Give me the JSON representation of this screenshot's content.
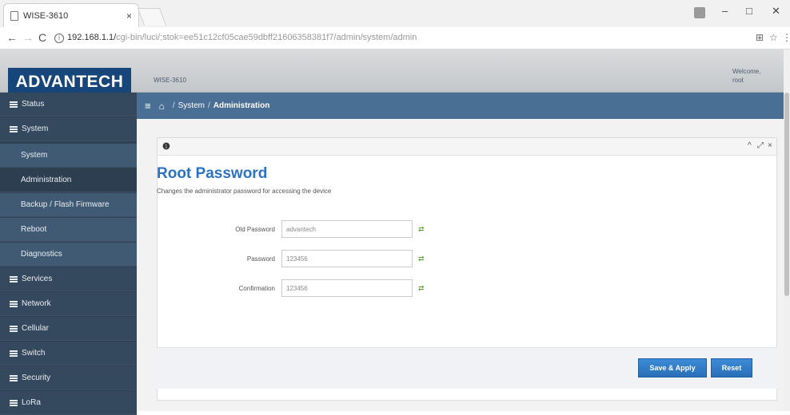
{
  "browser": {
    "tab_title": "WISE-3610",
    "tab_close": "×",
    "url_host": "192.168.1.1/",
    "url_path": "cgi-bin/luci/;stok=ee51c12cf05cae59dbff21606358381f7/admin/system/admin",
    "window_min": "–",
    "window_max": "□",
    "window_close": "✕",
    "back": "←",
    "forward": "→",
    "reload": "C",
    "info": "i",
    "translate_icon": "⊞",
    "bookmark_icon": "☆",
    "menu_icon": "⋮"
  },
  "header": {
    "logo": "ADVANTECH",
    "device_name": "WISE-3610",
    "welcome": "Welcome,",
    "user": "root"
  },
  "sidebar": {
    "items": [
      {
        "label": "Status"
      },
      {
        "label": "System"
      },
      {
        "label": "System"
      },
      {
        "label": "Administration"
      },
      {
        "label": "Backup / Flash Firmware"
      },
      {
        "label": "Reboot"
      },
      {
        "label": "Diagnostics"
      },
      {
        "label": "Services"
      },
      {
        "label": "Network"
      },
      {
        "label": "Cellular"
      },
      {
        "label": "Switch"
      },
      {
        "label": "Security"
      },
      {
        "label": "LoRa"
      }
    ]
  },
  "breadcrumb": {
    "menu": "≡",
    "home": "⌂",
    "sep": "/",
    "section": "System",
    "page": "Administration"
  },
  "panel": {
    "info_icon": "❶",
    "collapse": "^",
    "expand": "⤢",
    "close": "×",
    "title": "Root Password",
    "description": "Changes the administrator password for accessing the device"
  },
  "form": {
    "old_password_label": "Old Password",
    "old_password_value": "advantech",
    "password_label": "Password",
    "password_value": "123456",
    "confirmation_label": "Confirmation",
    "confirmation_value": "123456",
    "reveal_icon": "⇄"
  },
  "actions": {
    "save_apply": "Save & Apply",
    "reset": "Reset"
  }
}
